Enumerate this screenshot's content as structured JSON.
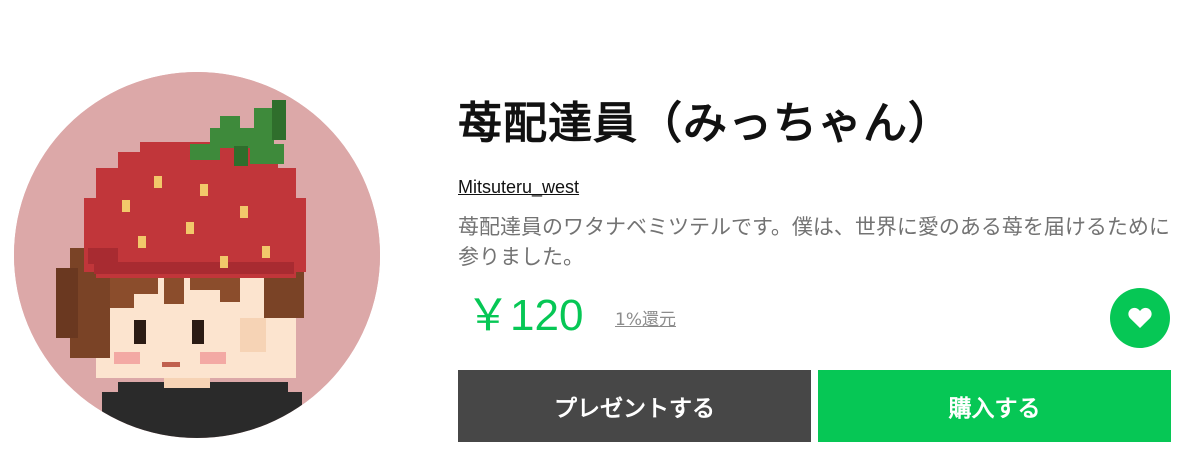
{
  "product": {
    "title": "苺配達員（みっちゃん）",
    "author": "Mitsuteru_west",
    "description": "苺配達員のワタナベミツテルです。僕は、世界に愛のある苺を届けるために参りました。",
    "price": "￥120",
    "cashback": "1%還元"
  },
  "actions": {
    "gift_label": "プレゼントする",
    "buy_label": "購入する"
  },
  "icons": {
    "favorite": "heart-icon"
  },
  "colors": {
    "accent": "#06c755",
    "gift_button": "#474747",
    "avatar_background": "#dca8a8"
  }
}
